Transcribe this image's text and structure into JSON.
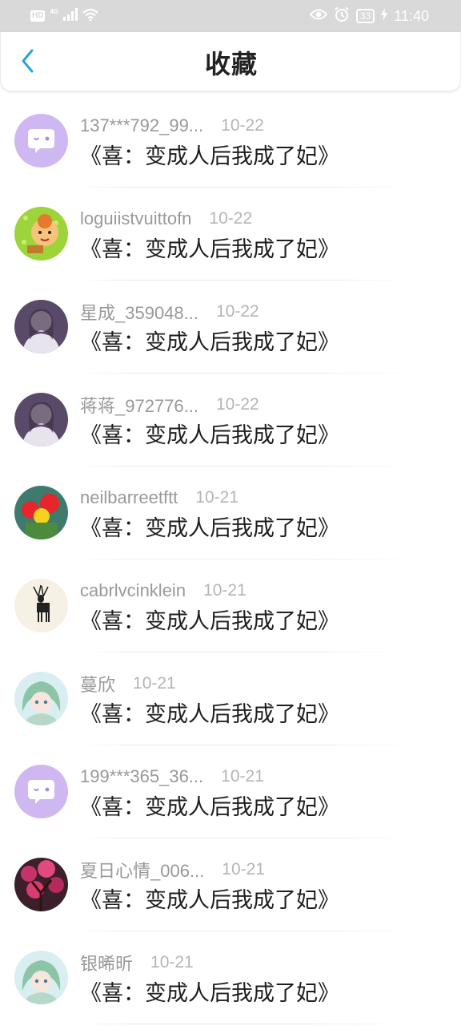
{
  "status_bar": {
    "hd": "HD",
    "network": "4G",
    "battery": "33",
    "time": "11:40"
  },
  "header": {
    "title": "收藏",
    "back_icon": "chevron-left-icon"
  },
  "colors": {
    "accent": "#2aa3d9",
    "status_bar_bg": "#d9d9d9",
    "default_avatar": "#cfb7f2"
  },
  "items": [
    {
      "username": "137***792_99...",
      "date": "10-22",
      "message": "《喜：变成人后我成了妃》",
      "avatar": "default-chat-avatar"
    },
    {
      "username": "loguiistvuittofn",
      "date": "10-22",
      "message": "《喜：变成人后我成了妃》",
      "avatar": "cartoon-avatar"
    },
    {
      "username": "星成_359048...",
      "date": "10-22",
      "message": "《喜：变成人后我成了妃》",
      "avatar": "photo-avatar"
    },
    {
      "username": "蒋蒋_972776...",
      "date": "10-22",
      "message": "《喜：变成人后我成了妃》",
      "avatar": "photo-avatar"
    },
    {
      "username": "neilbarreetftt",
      "date": "10-21",
      "message": "《喜：变成人后我成了妃》",
      "avatar": "flower-avatar"
    },
    {
      "username": "cabrlvcinklein",
      "date": "10-21",
      "message": "《喜：变成人后我成了妃》",
      "avatar": "deer-avatar"
    },
    {
      "username": "蔓欣",
      "date": "10-21",
      "message": "《喜：变成人后我成了妃》",
      "avatar": "anime-avatar"
    },
    {
      "username": "199***365_36...",
      "date": "10-21",
      "message": "《喜：变成人后我成了妃》",
      "avatar": "default-chat-avatar"
    },
    {
      "username": "夏日心情_006...",
      "date": "10-21",
      "message": "《喜：变成人后我成了妃》",
      "avatar": "blossom-avatar"
    },
    {
      "username": "银晞昕",
      "date": "10-21",
      "message": "《喜：变成人后我成了妃》",
      "avatar": "anime-avatar"
    }
  ]
}
